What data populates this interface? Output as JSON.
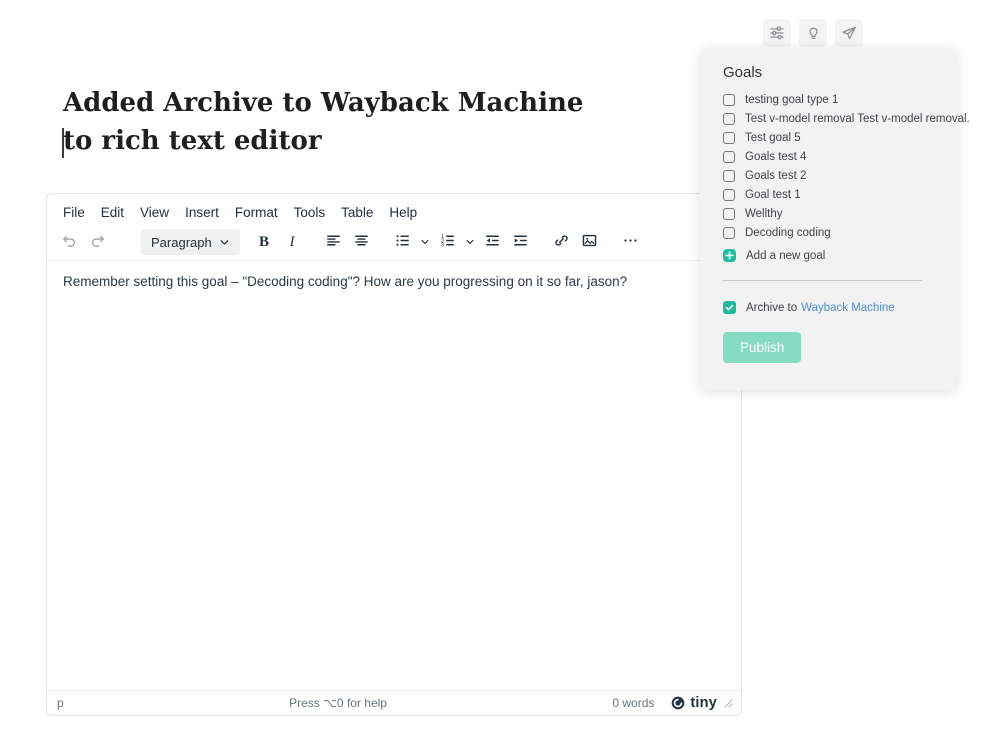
{
  "topbar": {
    "buttons": [
      {
        "icon": "sliders-icon"
      },
      {
        "icon": "lightbulb-icon"
      },
      {
        "icon": "send-icon"
      }
    ]
  },
  "post": {
    "title_lines": [
      "Added Archive to Wayback Machine",
      "to rich text editor"
    ]
  },
  "goals_panel": {
    "title": "Goals",
    "goals": [
      "testing goal type 1",
      "Test v-model removal Test v-model removal.",
      "Test goal 5",
      "Goals test 4",
      "Goals test 2",
      "Goal test 1",
      "Wellthy",
      "Decoding coding"
    ],
    "add_goal_label": "Add a new goal",
    "archive_label": "Archive to",
    "archive_link": "Wayback Machine",
    "archive_checked": true,
    "publish_label": "Publish"
  },
  "editor": {
    "menu": [
      "File",
      "Edit",
      "View",
      "Insert",
      "Format",
      "Tools",
      "Table",
      "Help"
    ],
    "paragraph_label": "Paragraph",
    "content": "Remember setting this goal – \"Decoding coding\"? How are you progressing on it so far, jason?",
    "statusbar": {
      "element_path": "p",
      "help_text": "Press ⌥0 for help",
      "word_count": "0 words",
      "brand": "tiny"
    }
  },
  "colors": {
    "accent_teal": "#1fbc9c",
    "publish_bg": "#85dcc3",
    "link_blue": "#4c8bd8",
    "panel_bg": "#f2f2f3"
  }
}
